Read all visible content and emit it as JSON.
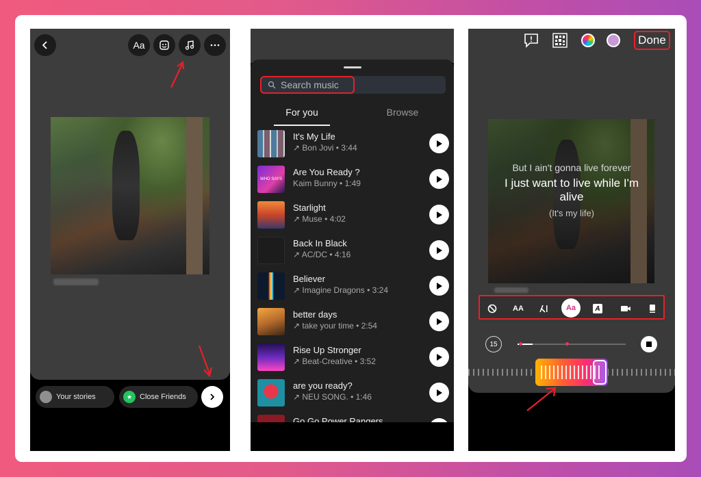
{
  "colors": {
    "highlight": "#e8202a",
    "bg_panel": "#3a3a3a",
    "sheet": "#202020",
    "accent_gradient": [
      "#ffb300",
      "#ff2d6f",
      "#8e3df2"
    ]
  },
  "panel1": {
    "toolbar": {
      "back_icon": "chevron-left-icon",
      "text_label": "Aa",
      "sticker_icon": "sticker-icon",
      "music_icon": "music-note-icon",
      "more_icon": "more-icon"
    },
    "bottom": {
      "your_stories": "Your stories",
      "close_friends": "Close Friends",
      "next_icon": "chevron-right-icon"
    }
  },
  "panel2": {
    "search": {
      "placeholder": "Search music"
    },
    "tabs": [
      {
        "label": "For you",
        "active": true
      },
      {
        "label": "Browse",
        "active": false
      }
    ],
    "songs": [
      {
        "title": "It's My Life",
        "meta": "↗ Bon Jovi • 3:44"
      },
      {
        "title": "Are You Ready ?",
        "meta": "Kaim Bunny • 1:49"
      },
      {
        "title": "Starlight",
        "meta": "↗ Muse • 4:02"
      },
      {
        "title": "Back In Black",
        "meta": "↗ AC/DC • 4:16"
      },
      {
        "title": "Believer",
        "meta": "↗ Imagine Dragons • 3:24"
      },
      {
        "title": "better days",
        "meta": "↗ take your time • 2:54"
      },
      {
        "title": "Rise Up Stronger",
        "meta": "↗ Beat-Creative • 3:52"
      },
      {
        "title": "are you ready?",
        "meta": "↗ NEU SONG. • 1:46"
      },
      {
        "title": "Go Go Power Rangers",
        "meta": ""
      }
    ],
    "thumb_texts": {
      "thumb2": "WHO SAYS"
    }
  },
  "panel3": {
    "top": {
      "done_label": "Done",
      "icons": [
        "feedback-icon",
        "qr-grid-icon",
        "color-wheel-icon",
        "avatar-sticker-icon"
      ]
    },
    "lyrics": {
      "line_prev": "But I ain't gonna live forever",
      "line_current": "I just want to live while I'm alive",
      "line_next": "(It's my life)"
    },
    "styles": {
      "labels": [
        "",
        "AA",
        "A",
        "Aa",
        "A",
        "",
        ""
      ]
    },
    "clip": {
      "duration": "15"
    }
  }
}
